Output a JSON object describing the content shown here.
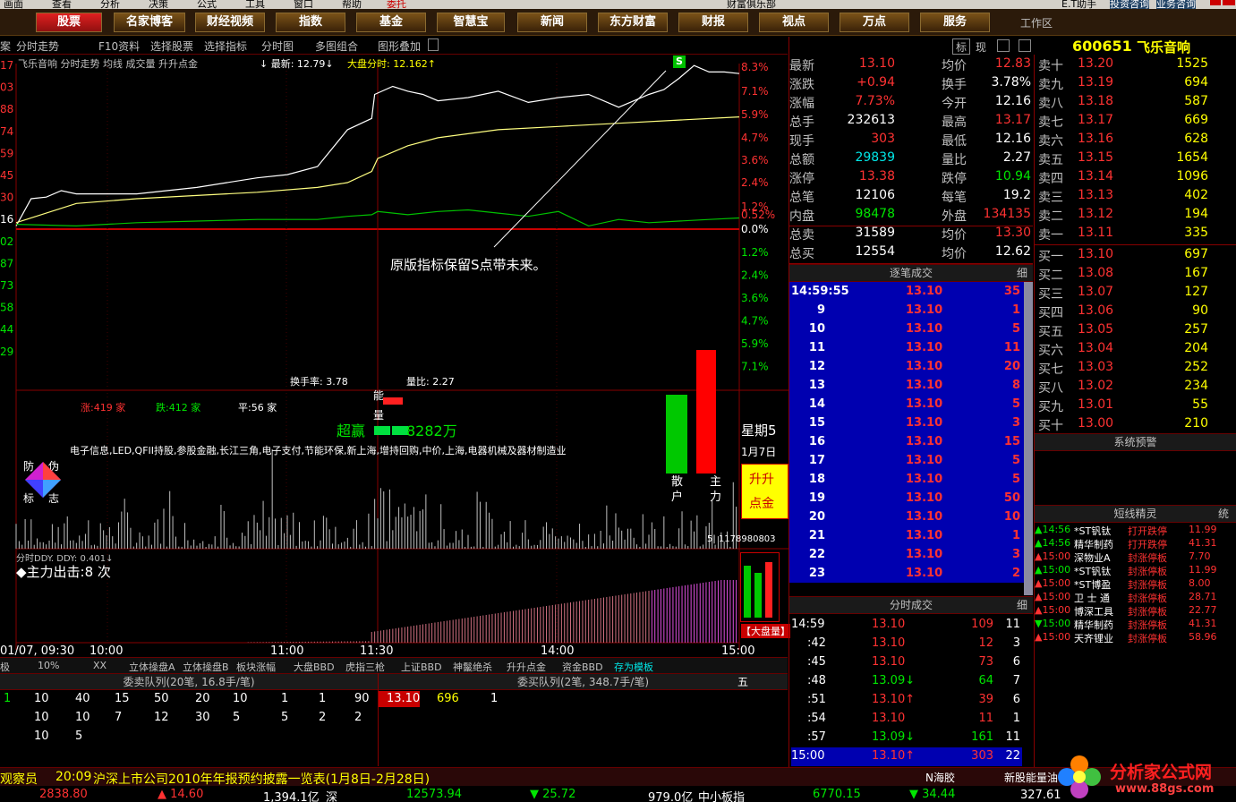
{
  "menubar": {
    "items": [
      "画面",
      "查看",
      "分析",
      "决策",
      "公式",
      "工具",
      "窗口",
      "帮助"
    ],
    "window_tabs": [
      "委托",
      "财富俱乐部",
      "E.T助手",
      "投资咨询",
      "业务咨询"
    ]
  },
  "nav": {
    "items": [
      "股票",
      "名家博客",
      "财经视频",
      "指数",
      "基金",
      "智慧宝",
      "新闻",
      "东方财富",
      "财报",
      "视点",
      "万点",
      "服务"
    ],
    "active": "股票",
    "workspace": "工作区"
  },
  "toolbar": {
    "items": [
      "案",
      "分时走势",
      "F10资料",
      "选择股票",
      "选择指标",
      "分时图",
      "多图组合",
      "图形叠加"
    ],
    "right_tabs": [
      "标",
      "现"
    ]
  },
  "stock": {
    "code": "600651",
    "name": "飞乐音响"
  },
  "chart_header": {
    "title": "飞乐音响 分时走势 均线 成交量 升升点金",
    "latest_label": "↓ 最新: 12.79↓",
    "index_label": "大盘分时: 12.162↑"
  },
  "chart_data": [
    {
      "type": "line",
      "title": "飞乐音响 分时走势",
      "x_ticks": [
        "01/07, 09:30",
        "10:00",
        "11:00",
        "11:30",
        "14:00",
        "15:00"
      ],
      "y_right_ticks_up": [
        "8.3%",
        "7.1%",
        "5.9%",
        "4.7%",
        "3.6%",
        "2.4%",
        "1.2%",
        "0.52%",
        "0.0%"
      ],
      "y_right_ticks_down": [
        "1.2%",
        "2.4%",
        "3.6%",
        "4.7%",
        "5.9%",
        "7.1%"
      ],
      "y_left_ticks": [
        "17",
        "03",
        "88",
        "74",
        "59",
        "45",
        "30",
        "16",
        "02",
        "87",
        "73",
        "58",
        "44",
        "29"
      ],
      "series": [
        {
          "color": "#ffffff",
          "x": [
            0,
            5,
            10,
            15,
            20,
            30,
            40,
            50,
            60,
            70,
            80,
            90,
            100,
            110,
            118,
            119,
            125,
            130,
            135,
            140,
            150,
            160,
            170,
            180,
            190,
            200,
            210,
            215,
            220,
            225,
            230,
            235,
            240
          ],
          "y": [
            12.18,
            12.35,
            12.36,
            12.4,
            12.38,
            12.38,
            12.38,
            12.4,
            12.42,
            12.45,
            12.48,
            12.5,
            12.55,
            12.78,
            12.85,
            13.0,
            13.05,
            13.02,
            13.0,
            12.96,
            12.98,
            13.02,
            12.95,
            12.98,
            13.0,
            12.92,
            13.0,
            13.03,
            13.1,
            13.18,
            13.14,
            13.14,
            13.13
          ]
        },
        {
          "color": "#ffff80",
          "x": [
            0,
            20,
            40,
            60,
            80,
            100,
            110,
            118,
            120,
            130,
            140,
            160,
            180,
            200,
            220,
            240
          ],
          "y": [
            12.2,
            12.32,
            12.35,
            12.37,
            12.39,
            12.42,
            12.45,
            12.52,
            12.6,
            12.68,
            12.73,
            12.78,
            12.8,
            12.82,
            12.84,
            12.86
          ]
        },
        {
          "color": "#00c000",
          "x": [
            0,
            20,
            40,
            60,
            80,
            100,
            110,
            118,
            120,
            130,
            140,
            150,
            160,
            170,
            180,
            190,
            200,
            210,
            220,
            230,
            240
          ],
          "y": [
            12.19,
            12.18,
            12.2,
            12.21,
            12.22,
            12.22,
            12.24,
            12.25,
            12.27,
            12.25,
            12.27,
            12.28,
            12.26,
            12.24,
            12.27,
            12.18,
            12.22,
            12.2,
            12.21,
            12.22,
            12.23
          ]
        }
      ]
    },
    {
      "type": "bar",
      "title": "成交量",
      "label_huanshou": "换手率: 3.78",
      "label_liangbi": "量比: 2.27",
      "seed": 7
    },
    {
      "type": "bar",
      "title": "分时DDY",
      "label": "分时DDY. DDY: 0.401↓",
      "zhuli": "◆主力出击:8 次"
    }
  ],
  "overlay": {
    "annotation": "原版指标保留S点带未来。",
    "s_mark": "S",
    "neng_liang": "能量",
    "chaoying": "超赢",
    "chaoying_val": "8282万",
    "zhang": "涨:419 家",
    "die": "跌:412 家",
    "ping": "平:56 家",
    "concepts": "电子信息,LED,QFII持股,参股金融,长江三角,电子支付,节能环保,新上海,增持回购,中价,上海,电器机械及器材制造业",
    "week": "星期5",
    "date": "1月7日",
    "shengsheng": "升升",
    "dianjin": "点金",
    "sanhu": "散户",
    "zhuli": "主力",
    "fangwei": [
      "防",
      "伪",
      "标",
      "志"
    ],
    "vol_value": "5| 1178980803",
    "dapanliang": "【大盘量】"
  },
  "quotes": [
    [
      "最新",
      "13.10",
      "均价",
      "12.83"
    ],
    [
      "涨跌",
      "+0.94",
      "换手",
      "3.78%"
    ],
    [
      "涨幅",
      "7.73%",
      "今开",
      "12.16"
    ],
    [
      "总手",
      "232613",
      "最高",
      "13.17"
    ],
    [
      "现手",
      "303",
      "最低",
      "12.16"
    ],
    [
      "总额",
      "29839",
      "量比",
      "2.27"
    ],
    [
      "涨停",
      "13.38",
      "跌停",
      "10.94"
    ],
    [
      "总笔",
      "12106",
      "每笔",
      "19.2"
    ],
    [
      "内盘",
      "98478",
      "外盘",
      "134135"
    ],
    [
      "总卖",
      "31589",
      "均价",
      "13.30"
    ],
    [
      "总买",
      "12554",
      "均价",
      "12.62"
    ]
  ],
  "orderbook": {
    "sells": [
      [
        "卖十",
        "13.20",
        "1525"
      ],
      [
        "卖九",
        "13.19",
        "694"
      ],
      [
        "卖八",
        "13.18",
        "587"
      ],
      [
        "卖七",
        "13.17",
        "669"
      ],
      [
        "卖六",
        "13.16",
        "628"
      ],
      [
        "卖五",
        "13.15",
        "1654"
      ],
      [
        "卖四",
        "13.14",
        "1096"
      ],
      [
        "卖三",
        "13.13",
        "402"
      ],
      [
        "卖二",
        "13.12",
        "194"
      ],
      [
        "卖一",
        "13.11",
        "335"
      ]
    ],
    "buys": [
      [
        "买一",
        "13.10",
        "697"
      ],
      [
        "买二",
        "13.08",
        "167"
      ],
      [
        "买三",
        "13.07",
        "127"
      ],
      [
        "买四",
        "13.06",
        "90"
      ],
      [
        "买五",
        "13.05",
        "257"
      ],
      [
        "买六",
        "13.04",
        "204"
      ],
      [
        "买七",
        "13.03",
        "252"
      ],
      [
        "买八",
        "13.02",
        "234"
      ],
      [
        "买九",
        "13.01",
        "55"
      ],
      [
        "买十",
        "13.00",
        "210"
      ]
    ]
  },
  "ticks": {
    "title": "逐笔成交",
    "detail": "细",
    "rows": [
      [
        "14:59:55",
        "13.10",
        "35"
      ],
      [
        "9",
        "13.10",
        "1"
      ],
      [
        "10",
        "13.10",
        "5"
      ],
      [
        "11",
        "13.10",
        "11"
      ],
      [
        "12",
        "13.10",
        "20"
      ],
      [
        "13",
        "13.10",
        "8"
      ],
      [
        "14",
        "13.10",
        "5"
      ],
      [
        "15",
        "13.10",
        "3"
      ],
      [
        "16",
        "13.10",
        "15"
      ],
      [
        "17",
        "13.10",
        "5"
      ],
      [
        "18",
        "13.10",
        "5"
      ],
      [
        "19",
        "13.10",
        "50"
      ],
      [
        "20",
        "13.10",
        "10"
      ],
      [
        "21",
        "13.10",
        "1"
      ],
      [
        "22",
        "13.10",
        "3"
      ],
      [
        "23",
        "13.10",
        "2"
      ]
    ]
  },
  "minute_trades": {
    "title": "分时成交",
    "detail": "细",
    "rows": [
      [
        "14:59",
        "13.10",
        "109",
        "11"
      ],
      [
        ":42",
        "13.10",
        "12",
        "3"
      ],
      [
        ":45",
        "13.10",
        "73",
        "6"
      ],
      [
        ":48",
        "13.09↓",
        "64",
        "7"
      ],
      [
        ":51",
        "13.10↑",
        "39",
        "6"
      ],
      [
        ":54",
        "13.10",
        "11",
        "1"
      ],
      [
        ":57",
        "13.09↓",
        "161",
        "11"
      ],
      [
        "15:00",
        "13.10↑",
        "303",
        "22"
      ]
    ]
  },
  "alerts": {
    "title": "系统预警",
    "title2": "短线精灵",
    "tab": "统",
    "rows": [
      [
        "▲14:56",
        "*ST钒钛",
        "打开跌停",
        "11.99",
        "g"
      ],
      [
        "▲14:56",
        "精华制药",
        "打开跌停",
        "41.31",
        "g"
      ],
      [
        "▲15:00",
        "深物业A",
        "封涨停板",
        "7.70",
        "r"
      ],
      [
        "▲15:00",
        "*ST钒钛",
        "封涨停板",
        "11.99",
        "g"
      ],
      [
        "▲15:00",
        "*ST博盈",
        "封涨停板",
        "8.00",
        "r"
      ],
      [
        "▲15:00",
        "卫 士 通",
        "封涨停板",
        "28.71",
        "r"
      ],
      [
        "▲15:00",
        "博深工具",
        "封涨停板",
        "22.77",
        "r"
      ],
      [
        "▼15:00",
        "精华制药",
        "封涨停板",
        "41.31",
        "g"
      ],
      [
        "▲15:00",
        "天齐锂业",
        "封涨停板",
        "58.96",
        "r"
      ]
    ]
  },
  "bottom_tabs": [
    "极",
    "10%",
    "XX",
    "立体操盘A",
    "立体操盘B",
    "板块涨幅",
    "大盘BBD",
    "虎指三枪",
    "上证BBD",
    "神鬣绝杀",
    "升升点金",
    "资金BBD",
    "存为模板"
  ],
  "queue": {
    "sell_title": "委卖队列(20笔, 16.8手/笔)",
    "buy_title": "委买队列(2笔, 348.7手/笔)",
    "sell_rows": [
      [
        "1",
        "10",
        "40",
        "15",
        "50",
        "20",
        "10",
        "1",
        "1",
        "90"
      ],
      [
        "",
        "10",
        "10",
        "7",
        "12",
        "30",
        "5",
        "5",
        "2",
        "2"
      ],
      [
        "",
        "10",
        "5"
      ]
    ],
    "buy_row": [
      "13.10",
      "696",
      "1"
    ],
    "five": "五"
  },
  "news": {
    "prefix": "观察员",
    "time": "20:09",
    "text": "沪深上市公司2010年年报预约披露一览表(1月8日-2月28日)"
  },
  "statusbar": {
    "sh_index": "2838.80",
    "sh_change": "▲ 14.60",
    "sh_amount": "1,394.1亿",
    "sz_label": "深",
    "sz_index": "12573.94",
    "sz_change": "▼ 25.72",
    "sz_amount": "979.0亿",
    "zxb_label": "中小板指",
    "zxb_index": "6770.15",
    "zxb_change": "▼ 34.44",
    "nhg": "N海胶",
    "nl": "新股能量油",
    "nl_val": "327.61"
  },
  "logo": {
    "cn": "分析家公式网",
    "url": "www.88gs.com"
  }
}
